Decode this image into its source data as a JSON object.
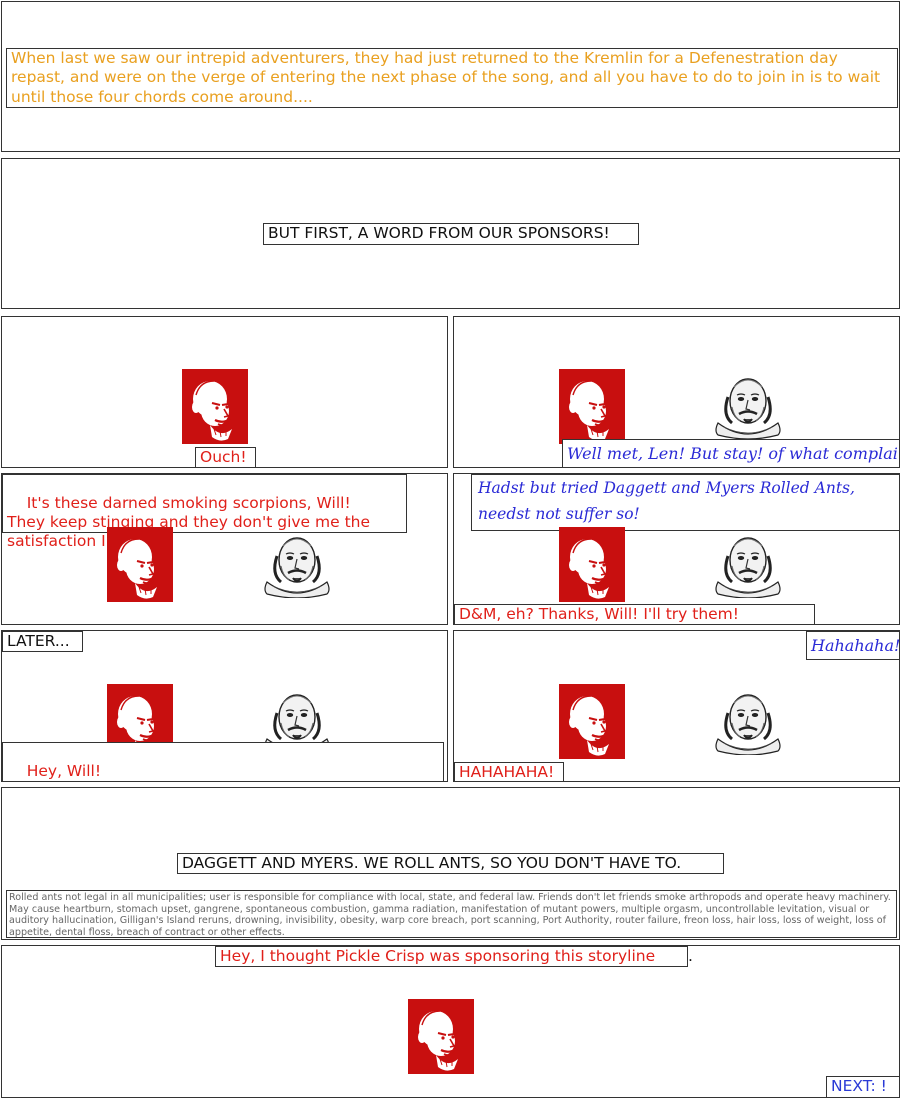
{
  "panels": {
    "intro": {
      "text": "When last we saw our intrepid adventurers, they had just returned to the Kremlin for a Defenestration day repast, and were on the verge of entering the next phase of the song, and all you have to do to join in is to wait until those four chords come around...."
    },
    "sponsor": {
      "text": "BUT FIRST, A WORD FROM OUR SPONSORS!"
    },
    "p3": {
      "lenin": "Ouch!"
    },
    "p4": {
      "will": "Well met, Len!  But stay! of what complainest?"
    },
    "p5": {
      "lenin": "It's these darned smoking scorpions, Will!\nThey keep stinging and they don't give me the satisfaction I want."
    },
    "p6": {
      "will": "Hadst but tried Daggett and Myers Rolled Ants, needst not suffer so!",
      "lenin": "D&M, eh?  Thanks, Will!  I'll try them!"
    },
    "p7": {
      "caption": "LATER...",
      "lenin": "Hey, Will!\nI tried D&M Rolled Ants, and they hit the spot!"
    },
    "p8": {
      "will": "Hahahaha!",
      "lenin": "HAHAHAHA!"
    },
    "ad": {
      "slogan": "DAGGETT AND MYERS.  WE ROLL ANTS, SO YOU DON'T HAVE TO.",
      "fine_print": "Rolled ants not legal in all municipalities; user is responsible for compliance with local, state, and federal law.  Friends don't let friends smoke arthropods and operate heavy machinery.  May cause heartburn, stomach upset, gangrene, spontaneous combustion, gamma radiation, manifestation of mutant powers, multiple orgasm, uncontrollable levitation, visual or auditory hallucination, Gilligan's Island reruns, drowning, invisibility, obesity, warp core breach, port scanning, Port Authority, router failure, freon loss, hair loss, loss of weight, loss of appetite, dental floss, breach of contract or other effects."
    },
    "final": {
      "lenin": "Hey, I thought Pickle Crisp was sponsoring this storyline",
      "trail": ".",
      "next": "NEXT: !"
    }
  },
  "colors": {
    "lenin_text": "#e0201a",
    "will_text": "#2a2ad6",
    "narration": "#e9a020",
    "portrait_bg": "#c80f0f"
  }
}
